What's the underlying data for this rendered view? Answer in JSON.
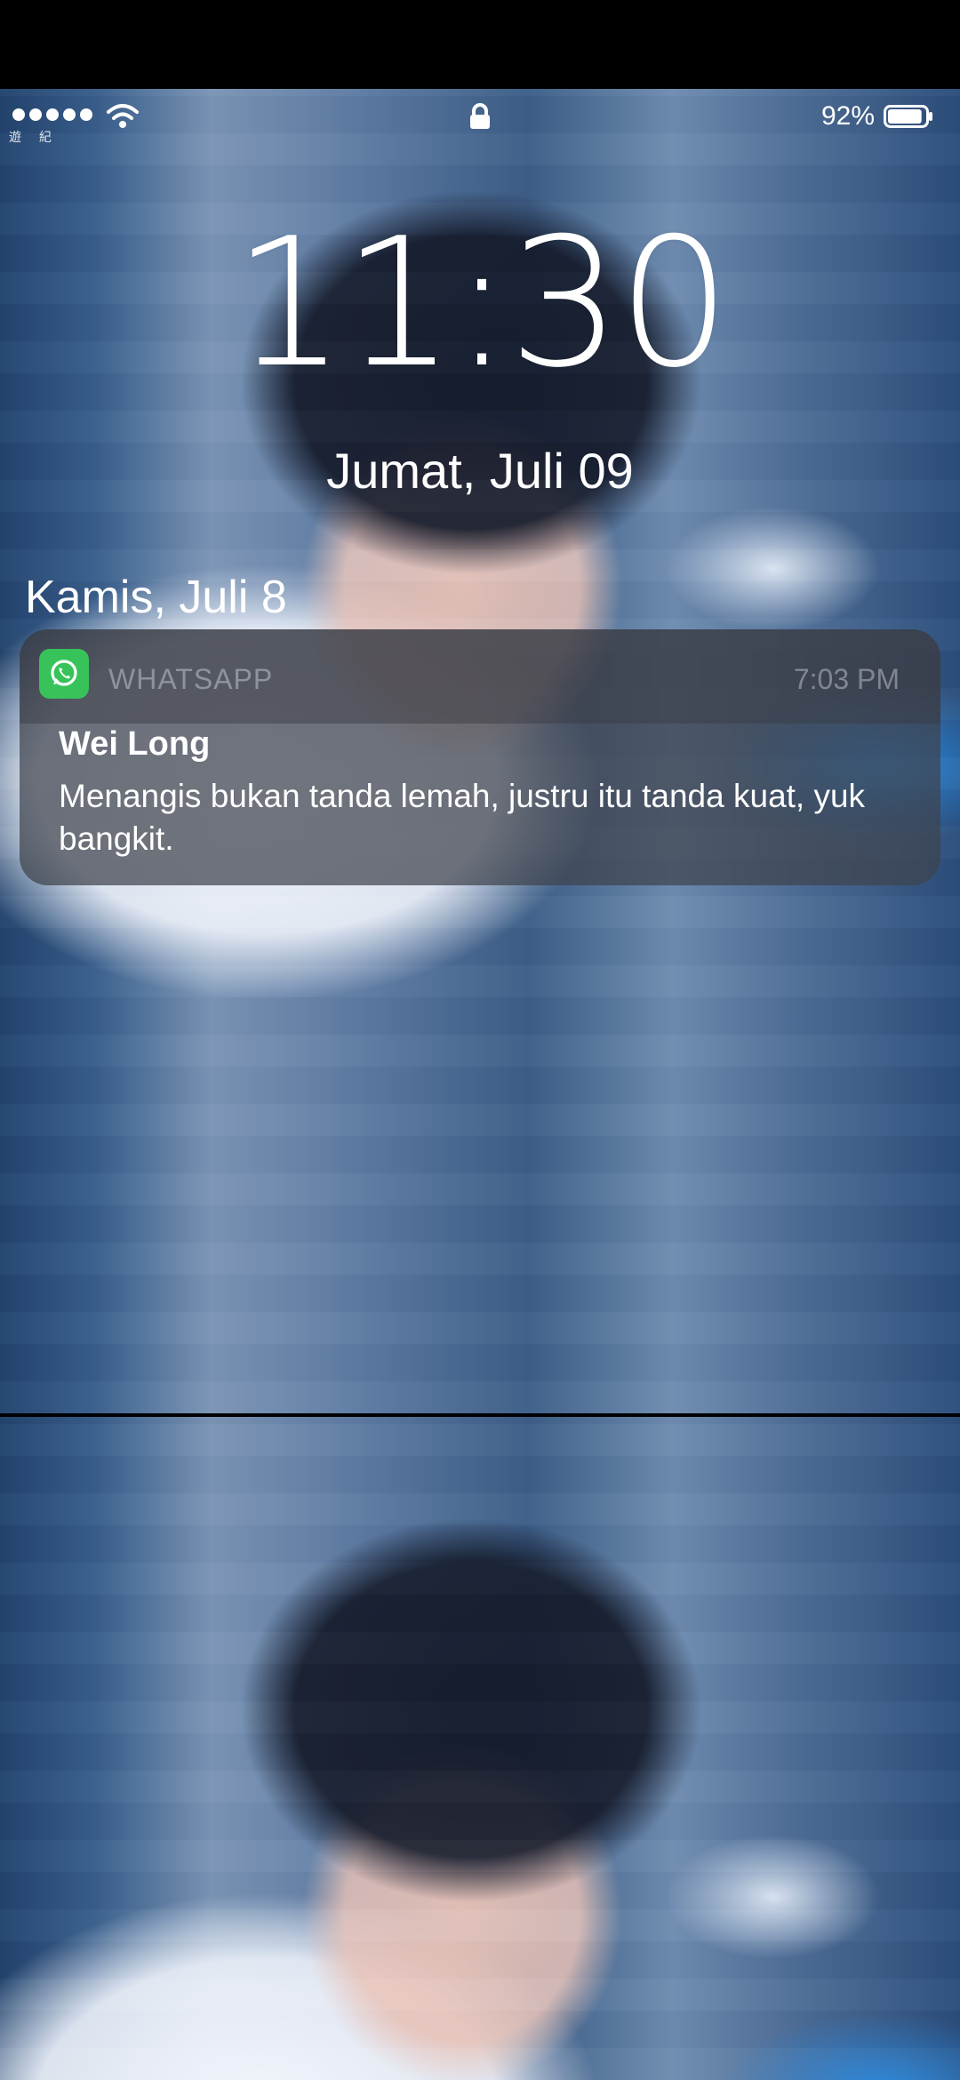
{
  "status_bar": {
    "signal_icon": "signal-dots-icon",
    "wifi_icon": "wifi-icon",
    "carrier_text": "遊 紀",
    "lock_icon": "lock-icon",
    "battery_percent": "92%",
    "battery_icon": "battery-icon",
    "battery_level": 0.92
  },
  "lock_screen": {
    "time": "11:30",
    "date": "Jumat, Juli 09"
  },
  "notifications": {
    "section_date": "Kamis, Juli 8",
    "items": [
      {
        "app_name": "WHATSAPP",
        "app_icon": "whatsapp-icon",
        "time": "7:03 PM",
        "sender": "Wei Long",
        "message": "Menangis bukan tanda lemah, justru itu tanda kuat, yuk bangkit."
      }
    ]
  },
  "colors": {
    "whatsapp_green": "#37c35a",
    "notification_background": "#3e424c",
    "text_primary": "#ffffff"
  }
}
